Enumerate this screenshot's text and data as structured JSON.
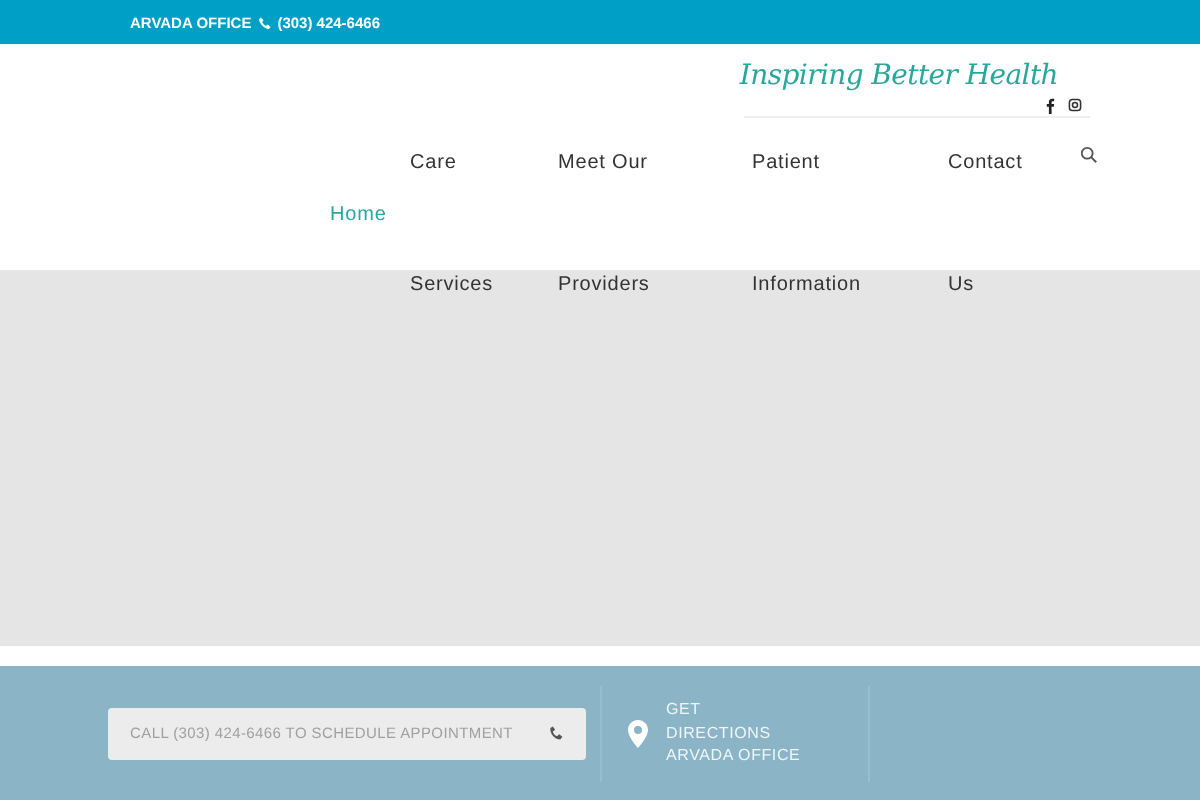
{
  "top_bar": {
    "office": "ARVADA OFFICE",
    "phone": "(303) 424-6466"
  },
  "header": {
    "tagline": "Inspiring Better Health"
  },
  "nav": [
    {
      "lines": [
        "Home"
      ],
      "selected": true
    },
    {
      "lines": [
        "Care",
        "Services"
      ],
      "selected": false
    },
    {
      "lines": [
        "Meet Our",
        "Providers"
      ],
      "selected": false
    },
    {
      "lines": [
        "Patient",
        "Information"
      ],
      "selected": false
    },
    {
      "lines": [
        "Contact",
        "Us"
      ],
      "selected": false
    }
  ],
  "footer": {
    "call_button": "CALL (303) 424-6466 TO SCHEDULE APPOINTMENT",
    "directions": [
      "GET",
      "DIRECTIONS",
      "ARVADA OFFICE"
    ]
  }
}
